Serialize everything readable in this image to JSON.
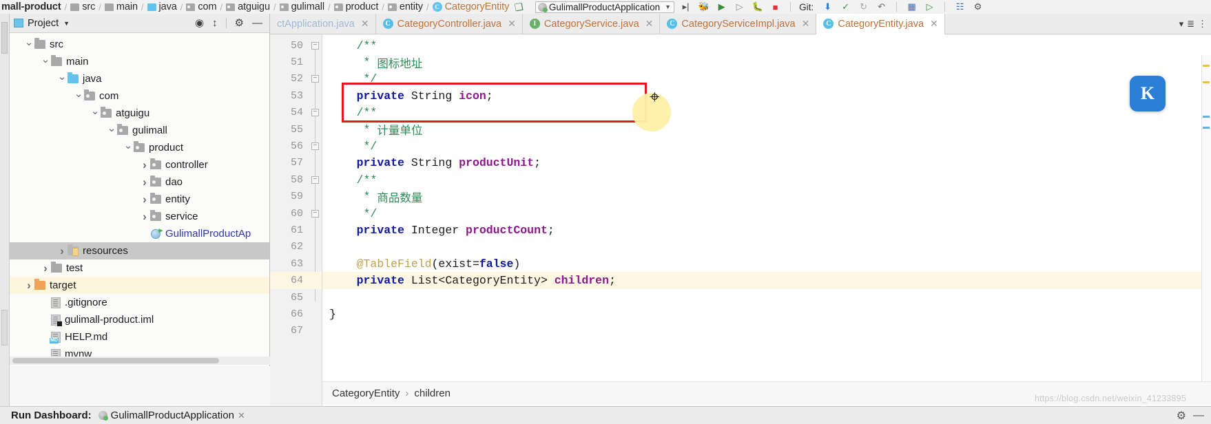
{
  "navbar": {
    "breadcrumbs": [
      {
        "label": "mall-product",
        "icon": "none",
        "bold": true
      },
      {
        "label": "src",
        "icon": "folder-gray"
      },
      {
        "label": "main",
        "icon": "folder-gray"
      },
      {
        "label": "java",
        "icon": "folder-blue"
      },
      {
        "label": "com",
        "icon": "package"
      },
      {
        "label": "atguigu",
        "icon": "package"
      },
      {
        "label": "gulimall",
        "icon": "package"
      },
      {
        "label": "product",
        "icon": "package"
      },
      {
        "label": "entity",
        "icon": "package"
      },
      {
        "label": "CategoryEntity",
        "icon": "class",
        "orange": true
      }
    ],
    "run_config": "GulimallProductApplication",
    "git_label": "Git:",
    "icons": [
      "hammer-icon",
      "run-icon",
      "debug-icon",
      "run-with-coverage-icon",
      "profiler-icon",
      "stop-icon",
      "attach-debugger-icon",
      "update-project-icon",
      "commit-icon",
      "history-icon",
      "rollback-icon",
      "search-everywhere-icon"
    ]
  },
  "project_panel": {
    "title": "Project",
    "header_icons": [
      "locate-icon",
      "collapse-all-icon",
      "settings-gear-icon",
      "hide-icon"
    ],
    "tree": [
      {
        "label": "src",
        "indent": 2,
        "arrow": "open",
        "icon": "folder-gray",
        "state": "normal"
      },
      {
        "label": "main",
        "indent": 3,
        "arrow": "open",
        "icon": "folder-gray",
        "state": "normal"
      },
      {
        "label": "java",
        "indent": 4,
        "arrow": "open",
        "icon": "folder-blue",
        "state": "normal"
      },
      {
        "label": "com",
        "indent": 5,
        "arrow": "open",
        "icon": "package",
        "state": "normal"
      },
      {
        "label": "atguigu",
        "indent": 6,
        "arrow": "open",
        "icon": "package",
        "state": "normal"
      },
      {
        "label": "gulimall",
        "indent": 7,
        "arrow": "open",
        "icon": "package",
        "state": "normal"
      },
      {
        "label": "product",
        "indent": 8,
        "arrow": "open",
        "icon": "package",
        "state": "normal"
      },
      {
        "label": "controller",
        "indent": 9,
        "arrow": "closed",
        "icon": "package",
        "state": "normal"
      },
      {
        "label": "dao",
        "indent": 9,
        "arrow": "closed",
        "icon": "package",
        "state": "normal"
      },
      {
        "label": "entity",
        "indent": 9,
        "arrow": "closed",
        "icon": "package",
        "state": "normal"
      },
      {
        "label": "service",
        "indent": 9,
        "arrow": "closed",
        "icon": "package",
        "state": "normal"
      },
      {
        "label": "GulimallProductAp",
        "indent": 9,
        "arrow": "none",
        "icon": "spring-class",
        "state": "normal",
        "blue": true
      },
      {
        "label": "resources",
        "indent": 4,
        "arrow": "closed",
        "icon": "folder-resources",
        "state": "selected"
      },
      {
        "label": "test",
        "indent": 3,
        "arrow": "closed",
        "icon": "folder-gray",
        "state": "normal"
      },
      {
        "label": "target",
        "indent": 2,
        "arrow": "closed",
        "icon": "folder-orange",
        "state": "highlight"
      },
      {
        "label": ".gitignore",
        "indent": 3,
        "arrow": "none",
        "icon": "file",
        "state": "normal"
      },
      {
        "label": "gulimall-product.iml",
        "indent": 3,
        "arrow": "none",
        "icon": "file-iml",
        "state": "normal"
      },
      {
        "label": "HELP.md",
        "indent": 3,
        "arrow": "none",
        "icon": "file-md",
        "state": "normal"
      },
      {
        "label": "mvnw",
        "indent": 3,
        "arrow": "none",
        "icon": "file",
        "state": "normal"
      }
    ]
  },
  "editor": {
    "tabs": [
      {
        "label": "ctApplication.java",
        "icon": "class-c",
        "active": false,
        "faded": true
      },
      {
        "label": "CategoryController.java",
        "icon": "class-c",
        "active": false
      },
      {
        "label": "CategoryService.java",
        "icon": "interface-i",
        "active": false
      },
      {
        "label": "CategoryServiceImpl.java",
        "icon": "class-c",
        "active": false
      },
      {
        "label": "CategoryEntity.java",
        "icon": "class-c",
        "active": true
      }
    ],
    "first_line_number": 50,
    "current_line": 64,
    "lines": [
      {
        "n": 50,
        "fold": "minus",
        "tokens": [
          {
            "t": "    ",
            "c": "pl"
          },
          {
            "t": "/**",
            "c": "cmt"
          }
        ]
      },
      {
        "n": 51,
        "fold": "none",
        "tokens": [
          {
            "t": "     * ",
            "c": "cmt"
          },
          {
            "t": "图标地址",
            "c": "cmt"
          }
        ]
      },
      {
        "n": 52,
        "fold": "minus",
        "tokens": [
          {
            "t": "     */",
            "c": "cmt"
          }
        ]
      },
      {
        "n": 53,
        "fold": "none",
        "tokens": [
          {
            "t": "    ",
            "c": "pl"
          },
          {
            "t": "private",
            "c": "kw"
          },
          {
            "t": " String ",
            "c": "typ"
          },
          {
            "t": "icon",
            "c": "fld"
          },
          {
            "t": ";",
            "c": "pl"
          }
        ]
      },
      {
        "n": 54,
        "fold": "minus",
        "tokens": [
          {
            "t": "    ",
            "c": "pl"
          },
          {
            "t": "/**",
            "c": "cmt"
          }
        ]
      },
      {
        "n": 55,
        "fold": "none",
        "tokens": [
          {
            "t": "     * ",
            "c": "cmt"
          },
          {
            "t": "计量单位",
            "c": "cmt"
          }
        ]
      },
      {
        "n": 56,
        "fold": "minus",
        "tokens": [
          {
            "t": "     */",
            "c": "cmt"
          }
        ]
      },
      {
        "n": 57,
        "fold": "none",
        "tokens": [
          {
            "t": "    ",
            "c": "pl"
          },
          {
            "t": "private",
            "c": "kw"
          },
          {
            "t": " String ",
            "c": "typ"
          },
          {
            "t": "productUnit",
            "c": "fld"
          },
          {
            "t": ";",
            "c": "pl"
          }
        ]
      },
      {
        "n": 58,
        "fold": "minus",
        "tokens": [
          {
            "t": "    ",
            "c": "pl"
          },
          {
            "t": "/**",
            "c": "cmt"
          }
        ]
      },
      {
        "n": 59,
        "fold": "none",
        "tokens": [
          {
            "t": "     * ",
            "c": "cmt"
          },
          {
            "t": "商品数量",
            "c": "cmt"
          }
        ]
      },
      {
        "n": 60,
        "fold": "minus",
        "tokens": [
          {
            "t": "     */",
            "c": "cmt"
          }
        ]
      },
      {
        "n": 61,
        "fold": "none",
        "tokens": [
          {
            "t": "    ",
            "c": "pl"
          },
          {
            "t": "private",
            "c": "kw"
          },
          {
            "t": " Integer ",
            "c": "typ"
          },
          {
            "t": "productCount",
            "c": "fld"
          },
          {
            "t": ";",
            "c": "pl"
          }
        ]
      },
      {
        "n": 62,
        "fold": "none",
        "tokens": []
      },
      {
        "n": 63,
        "fold": "none",
        "tokens": [
          {
            "t": "    ",
            "c": "pl"
          },
          {
            "t": "@TableField",
            "c": "ann"
          },
          {
            "t": "(exist=",
            "c": "pl"
          },
          {
            "t": "false",
            "c": "kw"
          },
          {
            "t": ")",
            "c": "pl"
          }
        ]
      },
      {
        "n": 64,
        "fold": "none",
        "tokens": [
          {
            "t": "    ",
            "c": "pl"
          },
          {
            "t": "private",
            "c": "kw"
          },
          {
            "t": " List<CategoryEntity> ",
            "c": "typ"
          },
          {
            "t": "children",
            "c": "fld"
          },
          {
            "t": ";",
            "c": "pl"
          }
        ]
      },
      {
        "n": 65,
        "fold": "none",
        "tokens": []
      },
      {
        "n": 66,
        "fold": "none",
        "tokens": [
          {
            "t": "}",
            "c": "pl"
          }
        ]
      },
      {
        "n": 67,
        "fold": "none",
        "tokens": []
      }
    ],
    "annotation_box_color": "#e01b1b",
    "breadcrumb": {
      "class_name": "CategoryEntity",
      "separator": "›",
      "member": "children"
    },
    "assistant_badge": "K"
  },
  "bottom_bar": {
    "label": "Run Dashboard:",
    "item": "GulimallProductApplication",
    "icons": [
      "spring-run-icon",
      "close-icon",
      "settings-icon",
      "hide-icon"
    ]
  },
  "watermark": "https://blog.csdn.net/weixin_41233895",
  "colors": {
    "accent_red": "#e01b1b",
    "current_line": "#fcf6e3",
    "tab_text": "#c0713b",
    "keyword": "#0f18a0",
    "field": "#8b1a8b",
    "comment": "#2e8b57",
    "annotation": "#c0a24a",
    "selection_gray": "#c8c8c8"
  }
}
